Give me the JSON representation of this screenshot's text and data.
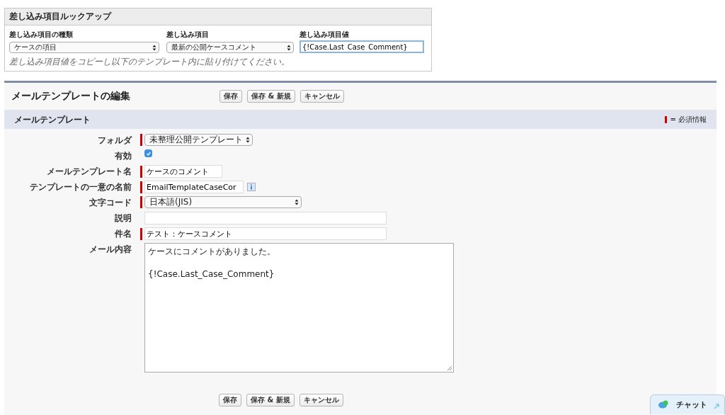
{
  "lookup": {
    "title": "差し込み項目ルックアップ",
    "type": {
      "label": "差し込み項目の種類",
      "value": "ケースの項目"
    },
    "field": {
      "label": "差し込み項目",
      "value": "最新の公開ケースコメント"
    },
    "merge_value": {
      "label": "差し込み項目値",
      "value": "{!Case.Last_Case_Comment}"
    },
    "hint": "差し込み項目値をコピーし以下のテンプレート内に貼り付けてください。"
  },
  "edit": {
    "title": "メールテンプレートの編集",
    "buttons": [
      "保存",
      "保存 & 新規",
      "キャンセル"
    ],
    "section": "メールテンプレート",
    "required_legend": "= 必須情報",
    "fields": [
      {
        "kind": "select",
        "label": "フォルダ",
        "value": "未整理公開テンプレート",
        "required": true
      },
      {
        "kind": "checkbox",
        "label": "有効",
        "checked": true,
        "required": false
      },
      {
        "kind": "text",
        "label": "メールテンプレート名",
        "value": "ケースのコメント",
        "required": true
      },
      {
        "kind": "text",
        "label": "テンプレートの一意の名前",
        "value": "EmailTemplateCaseCor",
        "required": true,
        "info": true
      },
      {
        "kind": "select",
        "label": "文字コード",
        "value": "日本語(JIS)",
        "required": true
      },
      {
        "kind": "text",
        "label": "説明",
        "required": false
      },
      {
        "kind": "text",
        "label": "件名",
        "value": "テスト：ケースコメント",
        "required": true
      },
      {
        "kind": "textarea",
        "label": "メール内容",
        "paragraphs": [
          "ケースにコメントがありました。",
          "{!Case.Last_Case_Comment}"
        ],
        "required": false
      }
    ],
    "footer_buttons": [
      "保存",
      "保存 & 新規",
      "キャンセル"
    ]
  },
  "chat": {
    "label": "チャット"
  }
}
